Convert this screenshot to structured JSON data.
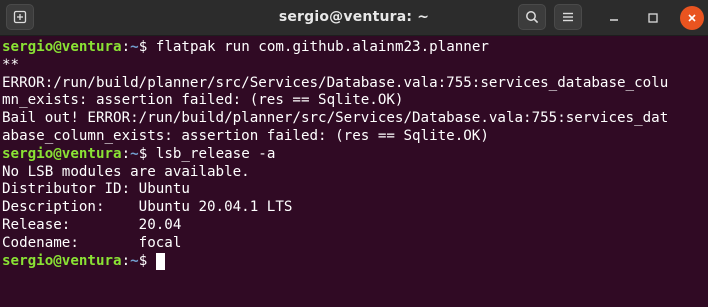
{
  "titlebar": {
    "title": "sergio@ventura: ~",
    "new_tab_icon": "new-tab-icon",
    "search_icon": "search-icon",
    "menu_icon": "hamburger-menu-icon",
    "minimize_icon": "minimize-icon",
    "maximize_icon": "maximize-icon",
    "close_icon": "close-icon",
    "close_color": "#e95420"
  },
  "prompt": {
    "user_host": "sergio@ventura",
    "colon": ":",
    "path": "~",
    "dollar": "$ "
  },
  "commands": {
    "first": "flatpak run com.github.alainm23.planner",
    "second": "lsb_release -a"
  },
  "output": {
    "l1": "**",
    "l2": "ERROR:/run/build/planner/src/Services/Database.vala:755:services_database_colu",
    "l3": "mn_exists: assertion failed: (res == Sqlite.OK)",
    "l4": "Bail out! ERROR:/run/build/planner/src/Services/Database.vala:755:services_dat",
    "l5": "abase_column_exists: assertion failed: (res == Sqlite.OK)",
    "l6": "No LSB modules are available.",
    "l7": "Distributor ID:\tUbuntu",
    "l8": "Description:\tUbuntu 20.04.1 LTS",
    "l9": "Release:\t20.04",
    "l10": "Codename:\tfocal"
  },
  "colors": {
    "background": "#300a24",
    "prompt_user": "#8ae234",
    "prompt_path": "#729fcf",
    "text": "#ffffff"
  }
}
